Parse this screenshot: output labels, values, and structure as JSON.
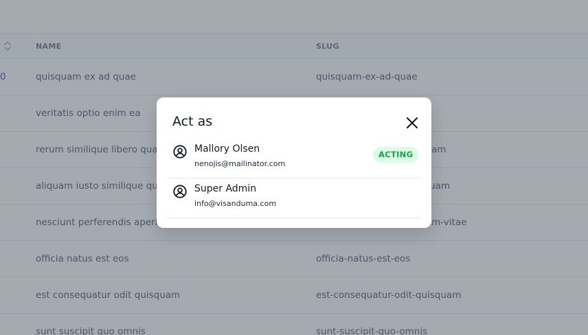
{
  "table": {
    "headers": {
      "name": "NAME",
      "slug": "SLUG"
    },
    "first_row_index": "0",
    "rows": [
      {
        "name": "quisquam ex ad quae",
        "slug": "quisquam-ex-ad-quae"
      },
      {
        "name": "veritatis optio enim ea",
        "slug": ""
      },
      {
        "name": "rerum similique libero quam",
        "slug": "am"
      },
      {
        "name": "aliquam iusto similique quam",
        "slug": "uam"
      },
      {
        "name": "nesciunt perferendis aperiam",
        "slug": "am-vitae"
      },
      {
        "name": "officia natus est eos",
        "slug": "officia-natus-est-eos"
      },
      {
        "name": "est consequatur odit quisquam",
        "slug": "est-consequatur-odit-quisquam"
      },
      {
        "name": "sunt suscipit quo omnis",
        "slug": "sunt-suscipit-quo-omnis"
      }
    ]
  },
  "modal": {
    "title": "Act as",
    "close_icon": "close-icon",
    "users": [
      {
        "name": "Mallory Olsen",
        "email": "nenojis@mailinator.com",
        "badge": "ACTING",
        "icon": "user-circle-icon"
      },
      {
        "name": "Super Admin",
        "email": "info@visanduma.com",
        "badge": "",
        "icon": "user-circle-icon"
      }
    ],
    "badge_color": "#16a34a",
    "badge_bg": "#dcfce7"
  },
  "colors": {
    "overlay": "rgba(75,85,99,0.5)",
    "index_link": "#4338ca"
  }
}
